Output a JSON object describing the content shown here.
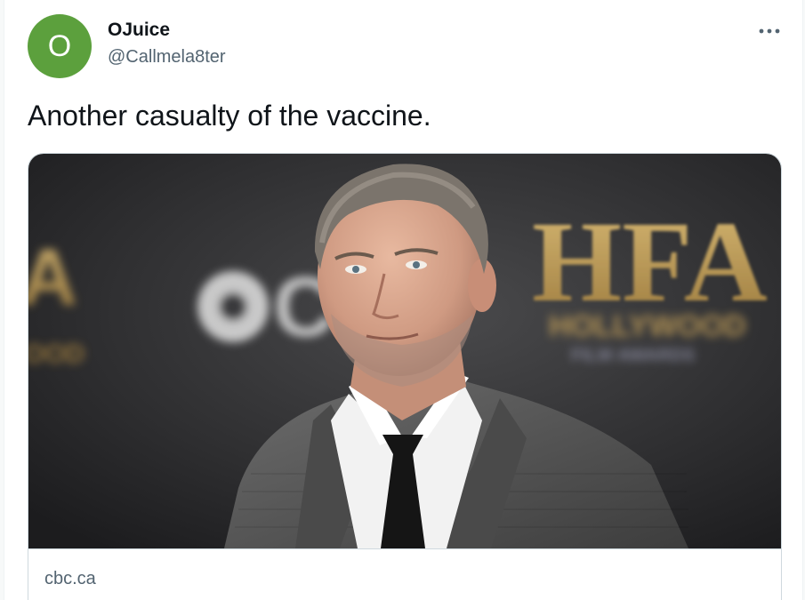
{
  "author": {
    "avatar_initial": "O",
    "display_name": "OJuice",
    "handle": "@Callmela8ter",
    "avatar_color": "#5ca03d"
  },
  "tweet": {
    "text": "Another casualty of the vaccine."
  },
  "card": {
    "domain": "cbc.ca",
    "image_backdrop_logo": "HFA",
    "image_backdrop_subtitle": "HOLLYWOOD",
    "image_backdrop_subtitle2": "FILM AWARDS"
  },
  "icons": {
    "more": "more-horizontal-icon"
  },
  "colors": {
    "text_primary": "#0f1419",
    "text_secondary": "#536471",
    "border": "#cfd9de"
  }
}
